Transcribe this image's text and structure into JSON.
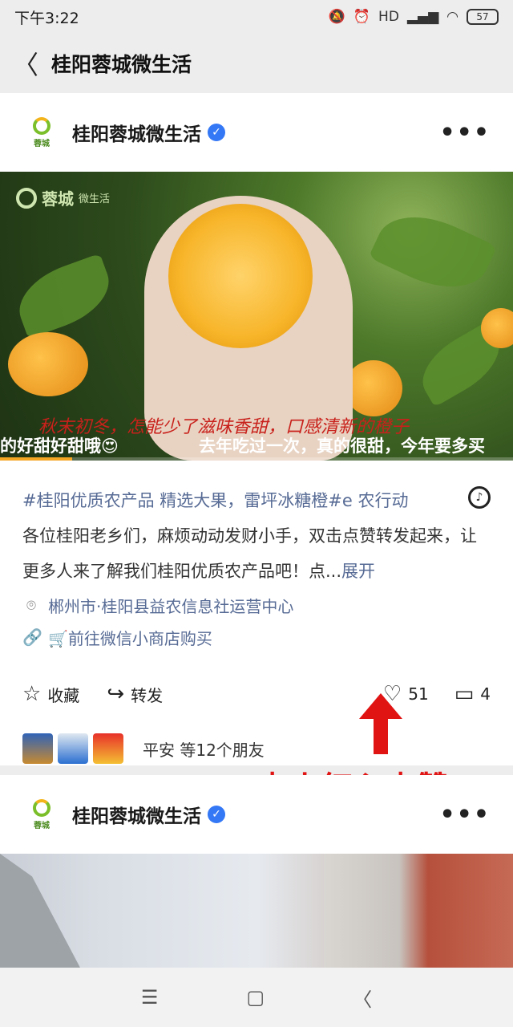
{
  "status_bar": {
    "time": "下午3:22",
    "signal": "HD",
    "battery": "57"
  },
  "nav": {
    "title": "桂阳蓉城微生活"
  },
  "post": {
    "account_name": "桂阳蓉城微生活",
    "logo_text": "蓉城",
    "media": {
      "logo_main": "蓉城",
      "logo_sub": "微生活",
      "subtitle": "秋末初冬，怎能少了滋味香甜，口感清新的橙子",
      "danmaku_left": "的好甜好甜哦😍",
      "danmaku_right": "去年吃过一次，真的很甜，今年要多买",
      "progress_fraction": 0.14
    },
    "description": {
      "tags": "#桂阳优质农产品 精选大果，雷坪冰糖橙#e 农行动",
      "body": "各位桂阳老乡们，麻烦动动发财小手，双击点赞转发起来，让更多人来了解我们桂阳优质农产品吧！点...",
      "expand": "展开"
    },
    "location": "郴州市·桂阳县益农信息社运营中心",
    "shop_link": "🛒前往微信小商店购买",
    "actions": {
      "favorite": "收藏",
      "share": "转发",
      "likes": "51",
      "comments": "4"
    },
    "friends_text": "平安 等12个朋友"
  },
  "annotation": {
    "text": "点小红心点赞",
    "color": "#e11414"
  },
  "post2": {
    "account_name": "桂阳蓉城微生活",
    "logo_text": "蓉城"
  },
  "icons": {
    "back": "chevron-left-icon",
    "more": "more-dots-icon",
    "music": "music-note-icon",
    "location": "location-pin-icon",
    "link": "link-icon",
    "favorite": "star-icon",
    "share": "share-arrow-icon",
    "like": "heart-icon",
    "comment": "comment-icon"
  }
}
